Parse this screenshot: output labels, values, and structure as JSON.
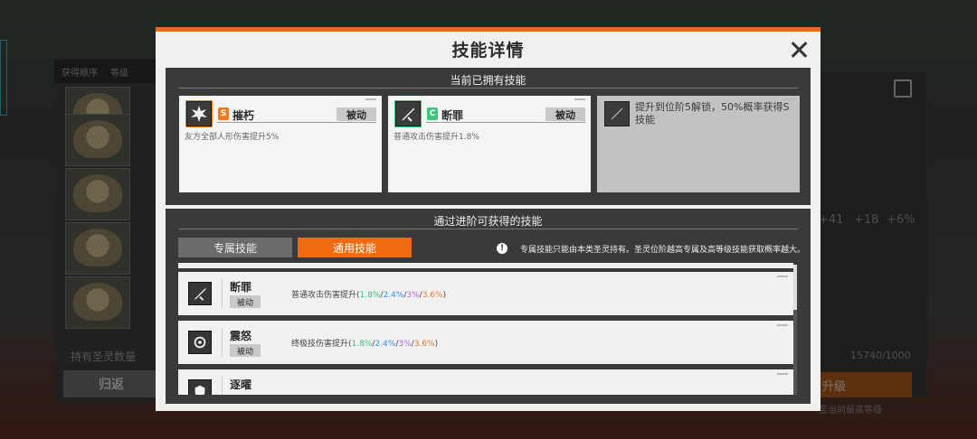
{
  "background": {
    "filter_label": "获得顺序",
    "filter_sort_label": "等级",
    "count_label": "持有圣灵数量",
    "back_label": "归返",
    "stats": [
      "+41",
      "+18",
      "+6%"
    ],
    "ratio": "15740/1000",
    "upgrade_label": "升级",
    "upgrade_note": "至当前最高等级"
  },
  "dialog": {
    "title": "技能详情",
    "owned_section": {
      "title": "当前已拥有技能",
      "cards": [
        {
          "grade": "S",
          "name": "摧朽",
          "tag": "被动",
          "desc": "友方全部人形伤害提升5%"
        },
        {
          "grade": "C",
          "name": "断罪",
          "tag": "被动",
          "desc": "普通攻击伤害提升1.8%"
        }
      ],
      "locked_text": "提升到位阶5解锁，50%概率获得S技能"
    },
    "advance_section": {
      "title": "通过进阶可获得的技能",
      "tabs": [
        "专属技能",
        "通用技能"
      ],
      "info_icon": "!",
      "info_text": "专属技能只能由本类圣灵持有。圣灵位阶越高专属及高等级技能获取概率越大。",
      "skills": [
        {
          "name": "断罪",
          "tag": "被动",
          "desc_prefix": "普通攻击伤害提升(",
          "values": [
            "1.8%",
            "2.4%",
            "3%",
            "3.6%"
          ],
          "desc_suffix": ")"
        },
        {
          "name": "震怒",
          "tag": "被动",
          "desc_prefix": "终极技伤害提升(",
          "values": [
            "1.8%",
            "2.4%",
            "3%",
            "3.6%"
          ],
          "desc_suffix": ")"
        },
        {
          "name": "逐曜",
          "tag": "",
          "desc_prefix": "",
          "values": [],
          "desc_suffix": ""
        }
      ]
    }
  },
  "colors": {
    "accent": "#f06a12",
    "grade_s": "#f07a22",
    "grade_c": "#3fc47a",
    "value_1": "#3cc07a",
    "value_2": "#3a8ee6",
    "value_3": "#b36ad8",
    "value_4": "#f07a22"
  },
  "icons": [
    "close-icon",
    "explosion-skill-icon",
    "sword-skill-icon",
    "locked-slot-icon",
    "burst-skill-icon",
    "shield-skill-icon",
    "info-icon"
  ]
}
